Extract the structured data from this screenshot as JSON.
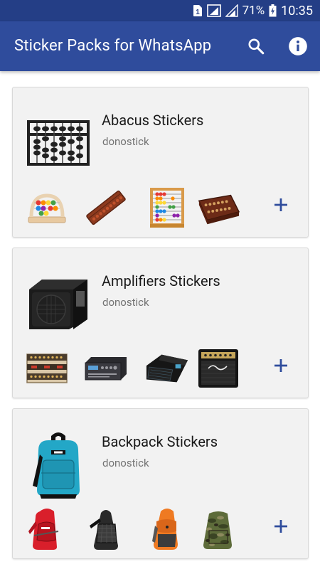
{
  "status_bar": {
    "sim_slot": "1",
    "battery_percent": "71%",
    "time": "10:35"
  },
  "app_bar": {
    "title": "Sticker Packs for WhatsApp",
    "search_icon": "search-icon",
    "info_icon": "info-icon"
  },
  "colors": {
    "status_bar": "#243e86",
    "app_bar": "#2f4c9c",
    "card_background": "#f2f2f2",
    "add_icon": "#2f4c9c"
  },
  "packs": [
    {
      "title": "Abacus Stickers",
      "author": "donostick",
      "tray_icon": "abacus-icon",
      "previews": [
        "abacus-icon",
        "abacus-icon",
        "abacus-icon",
        "abacus-icon"
      ],
      "add_icon": "plus-icon"
    },
    {
      "title": "Amplifiers Stickers",
      "author": "donostick",
      "tray_icon": "amplifier-icon",
      "previews": [
        "amplifier-icon",
        "amplifier-icon",
        "amplifier-icon",
        "amplifier-icon"
      ],
      "add_icon": "plus-icon"
    },
    {
      "title": "Backpack Stickers",
      "author": "donostick",
      "tray_icon": "backpack-icon",
      "previews": [
        "backpack-icon",
        "backpack-icon",
        "backpack-icon",
        "backpack-icon"
      ],
      "add_icon": "plus-icon"
    }
  ]
}
